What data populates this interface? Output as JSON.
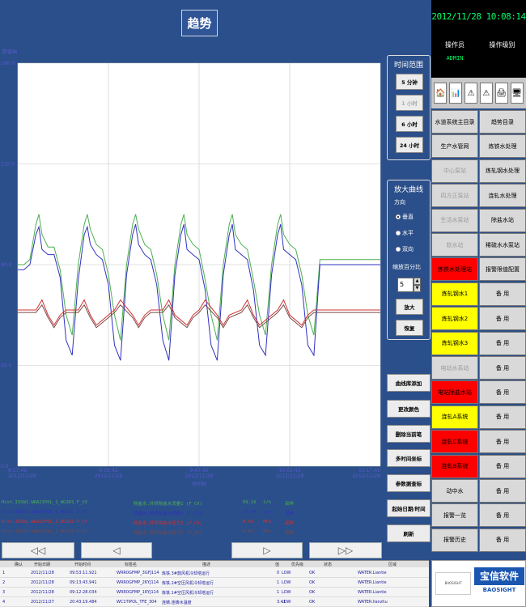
{
  "header": {
    "title": "趋势"
  },
  "chart": {
    "y_axis_title": "数值轴",
    "x_axis_title": "时间轴",
    "y_ticks": [
      "160.0",
      "120.0",
      "80.0",
      "40.0",
      "0.0"
    ],
    "x_ticks": [
      {
        "time": "9:17:42",
        "date": "2012/11/28"
      },
      {
        "time": "9:32:42",
        "date": "2012/11/28"
      },
      {
        "time": "9:47:42",
        "date": "2012/11/28"
      },
      {
        "time": "10:02:42",
        "date": "2012/11/28"
      },
      {
        "time": "10:17:42",
        "date": "2012/11/28"
      }
    ]
  },
  "chart_data": {
    "type": "line",
    "ylabel": "数值轴",
    "xlabel": "时间轴",
    "ylim": [
      0,
      160
    ],
    "xlim_minutes": [
      0,
      60
    ],
    "grid": true,
    "series": [
      {
        "color": "#4caf50",
        "x": [
          0,
          1,
          2,
          3,
          3.5,
          4,
          5,
          6,
          7,
          8,
          9,
          10,
          11,
          11.5,
          12,
          13,
          14,
          15,
          16,
          17,
          18,
          19,
          19.5,
          20,
          21,
          22,
          23,
          24,
          25,
          26,
          27,
          27.5,
          28,
          29,
          30,
          31,
          32,
          33,
          34,
          35,
          35.5,
          36,
          37,
          38,
          39,
          40,
          41,
          42,
          43,
          43.5,
          44,
          45,
          46,
          47,
          48,
          49,
          50,
          51,
          52,
          53,
          54,
          55,
          56,
          57,
          58,
          59,
          60
        ],
        "y": [
          80,
          80,
          82,
          96,
          100,
          92,
          87,
          87,
          78,
          60,
          52,
          80,
          96,
          100,
          94,
          88,
          86,
          76,
          60,
          50,
          80,
          96,
          100,
          94,
          88,
          86,
          76,
          60,
          50,
          80,
          96,
          100,
          92,
          88,
          86,
          74,
          60,
          50,
          80,
          96,
          100,
          92,
          88,
          86,
          74,
          60,
          52,
          80,
          96,
          100,
          92,
          88,
          86,
          76,
          60,
          52,
          82,
          82,
          82,
          82,
          82,
          82,
          82,
          82,
          82,
          82,
          82
        ]
      },
      {
        "color": "#3030c0",
        "x": [
          0,
          1,
          2,
          3,
          3.5,
          4,
          5,
          6,
          7,
          8,
          9,
          10,
          11,
          11.5,
          12,
          13,
          14,
          15,
          16,
          17,
          18,
          19,
          19.5,
          20,
          21,
          22,
          23,
          24,
          25,
          26,
          27,
          27.5,
          28,
          29,
          30,
          31,
          32,
          33,
          34,
          35,
          35.5,
          36,
          37,
          38,
          39,
          40,
          41,
          42,
          43,
          43.5,
          44,
          45,
          46,
          47,
          48,
          49,
          50,
          51,
          52,
          53,
          54,
          55,
          56,
          57,
          58,
          59,
          60
        ],
        "y": [
          78,
          78,
          80,
          92,
          95,
          86,
          84,
          84,
          75,
          50,
          44,
          74,
          92,
          95,
          88,
          84,
          82,
          72,
          48,
          42,
          76,
          92,
          96,
          88,
          84,
          82,
          72,
          50,
          42,
          76,
          92,
          96,
          86,
          84,
          82,
          70,
          48,
          42,
          76,
          92,
          96,
          86,
          84,
          82,
          70,
          48,
          44,
          76,
          92,
          96,
          86,
          84,
          82,
          72,
          48,
          44,
          80,
          80,
          80,
          80,
          80,
          80,
          80,
          80,
          80,
          80,
          80
        ]
      },
      {
        "color": "#d03030",
        "x": [
          0,
          3,
          4,
          5,
          6,
          7,
          8,
          10,
          11,
          12,
          13,
          15,
          16,
          17,
          19,
          20,
          21,
          22,
          24,
          25,
          26,
          28,
          29,
          30,
          31,
          33,
          34,
          35,
          37,
          38,
          39,
          40,
          42,
          43,
          44,
          45,
          47,
          48,
          49,
          50,
          60
        ],
        "y": [
          62,
          62,
          66,
          60,
          56,
          60,
          62,
          62,
          66,
          60,
          56,
          60,
          62,
          66,
          60,
          56,
          60,
          62,
          62,
          66,
          60,
          56,
          60,
          62,
          66,
          60,
          56,
          60,
          62,
          66,
          60,
          56,
          60,
          62,
          66,
          60,
          56,
          60,
          62,
          62,
          62
        ]
      },
      {
        "color": "#7a4a4a",
        "x": [
          0,
          3,
          4,
          5,
          6,
          7,
          8,
          10,
          11,
          12,
          13,
          15,
          16,
          17,
          19,
          20,
          21,
          22,
          24,
          25,
          26,
          28,
          29,
          30,
          31,
          33,
          34,
          35,
          37,
          38,
          39,
          40,
          42,
          43,
          44,
          45,
          47,
          48,
          49,
          50,
          60
        ],
        "y": [
          61,
          61,
          64,
          59,
          55,
          59,
          61,
          61,
          64,
          59,
          55,
          59,
          61,
          64,
          59,
          55,
          59,
          61,
          61,
          64,
          59,
          55,
          59,
          61,
          64,
          59,
          55,
          59,
          61,
          64,
          59,
          55,
          59,
          61,
          64,
          59,
          55,
          59,
          61,
          61,
          61
        ]
      }
    ]
  },
  "legend_rows": [
    {
      "tag": "Hist.IOSW1.WRA2IPOL_1_WG301.F_CV",
      "desc": "除盐水.外供除盐水流量1 (F_CV)",
      "value": "69.16",
      "unit": "t/h",
      "status": "采样",
      "color": "#4caf50"
    },
    {
      "tag": "Hist.IOSW1.WRA2IPOL_1_WG302.F_CV",
      "desc": "除盐水.外供除盐水流量2 (F_CV)",
      "value": "67.44",
      "unit": "t/h",
      "status": "采样",
      "color": "#3030c0"
    },
    {
      "tag": "Hist.IOSW1.WRA2IPOL_1_WG301.P_CV",
      "desc": "除盐水.外供除盐水压力1 (P_CV)",
      "value": "0.64",
      "unit": "MPa",
      "status": "采样",
      "color": "#d03030"
    },
    {
      "tag": "Hist.IOSW1.WRA2IPOL_1_WG302.P_CV",
      "desc": "除盐水.外供除盐水压力2 (P_CV)",
      "value": "0.63",
      "unit": "MPa",
      "status": "采样",
      "color": "#7a4a4a"
    }
  ],
  "time_range": {
    "title": "时间范围",
    "buttons": [
      "5 分钟",
      "1 小时",
      "6 小时",
      "24 小时"
    ]
  },
  "zoom": {
    "title": "放大曲线",
    "direction_label": "方向",
    "options": [
      "垂直",
      "水平",
      "双向"
    ],
    "selected": "双向",
    "ratio_label": "缩放百分比",
    "ratio_value": "5",
    "zoom_in": "放大",
    "restore": "恢复"
  },
  "tools": [
    "曲线库添加",
    "更改颜色",
    "删除当前笔",
    "多时间坐标",
    "参数据查标",
    "起始日期/时间",
    "刷新"
  ],
  "clock": "2012/11/28 10:08:14",
  "operator": {
    "label": "操作员",
    "name": "ADMIN",
    "level_label": "操作级别"
  },
  "nav": [
    [
      "水道系统主目录",
      "趋势目录"
    ],
    [
      "生产水管网",
      "炼铁水处理"
    ],
    [
      "中心泵站",
      "炼轧钢水处理"
    ],
    [
      "四方正泵站",
      "连轧水处理"
    ],
    [
      "生活水泵站",
      "除盐水站"
    ],
    [
      "软水站",
      "稀硫水水泵站"
    ],
    [
      "炼铁水处理站",
      "报警限值配置"
    ],
    [
      "炼轧钢水1",
      "备 用"
    ],
    [
      "炼轧钢水2",
      "备 用"
    ],
    [
      "炼轧钢水3",
      "备 用"
    ],
    [
      "电站水系站",
      "备 用"
    ],
    [
      "电站除盐水站",
      "备 用"
    ],
    [
      "连轧A系统",
      "备 用"
    ],
    [
      "连轧C系统",
      "备 用"
    ],
    [
      "连轧B系统",
      "备 用"
    ],
    [
      "动中水",
      "备 用"
    ],
    [
      "报警一览",
      "备 用"
    ],
    [
      "报警历史",
      "备 用"
    ]
  ],
  "alarm": {
    "headers": [
      "确认",
      "开始日期",
      "开始时间",
      "标签名",
      "描述",
      "值",
      "优先级",
      "状态",
      "区域"
    ],
    "rows": [
      {
        "n": "1",
        "date": "2012/11/28",
        "time": "09:53:11.921",
        "tag": "WRR0GFMP_3GFJ114",
        "desc": "炼铁.3#鼓风机冷却塔运行",
        "value": "0",
        "pri": "LOW",
        "state": "OK",
        "area": "WATER.Liantie"
      },
      {
        "n": "2",
        "date": "2012/11/28",
        "time": "09:13:43.941",
        "tag": "WRR0GFMP_2KYJ114",
        "desc": "炼铁.2#空压风机冷却塔运行",
        "value": "1",
        "pri": "LOW",
        "state": "OK",
        "area": "WATER.Liantie"
      },
      {
        "n": "3",
        "date": "2012/11/28",
        "time": "09:12:28.034",
        "tag": "WRR0GFMP_1KYJ114",
        "desc": "炼铁.1#空压风机冷却塔运行",
        "value": "1",
        "pri": "LOW",
        "state": "OK",
        "area": "WATER.Liantie"
      },
      {
        "n": "4",
        "date": "2012/11/27",
        "time": "20:43:19.484",
        "tag": "WC1TIPOL_TFE_304",
        "desc": "连铸.连铸水温度",
        "value": "3.41",
        "pri": "LOW",
        "state": "OK",
        "area": "WATER.lianzhu"
      }
    ]
  },
  "logo": {
    "text": "宝信软件",
    "sub": "BAOSIGHT",
    "mark": "BAOSIGHT"
  }
}
